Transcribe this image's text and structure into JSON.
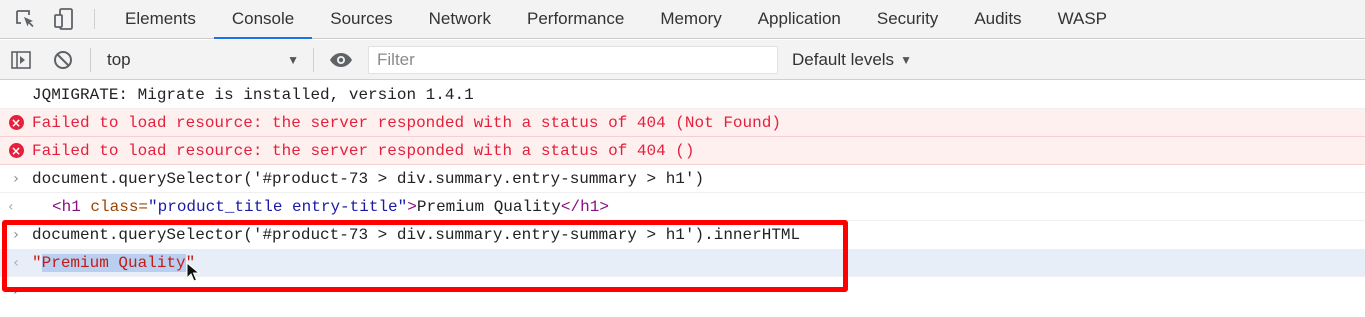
{
  "tabs": [
    {
      "label": "Elements",
      "active": false
    },
    {
      "label": "Console",
      "active": true
    },
    {
      "label": "Sources",
      "active": false
    },
    {
      "label": "Network",
      "active": false
    },
    {
      "label": "Performance",
      "active": false
    },
    {
      "label": "Memory",
      "active": false
    },
    {
      "label": "Application",
      "active": false
    },
    {
      "label": "Security",
      "active": false
    },
    {
      "label": "Audits",
      "active": false
    },
    {
      "label": "WASP",
      "active": false
    }
  ],
  "toolbar": {
    "context_label": "top",
    "filter_placeholder": "Filter",
    "levels_label": "Default levels"
  },
  "console": {
    "log_jqmigrate": "JQMIGRATE: Migrate is installed, version 1.4.1",
    "error_1": "Failed to load resource: the server responded with a status of 404 (Not Found)",
    "error_2": "Failed to load resource: the server responded with a status of 404 ()",
    "command_1": "document.querySelector('#product-73 > div.summary.entry-summary > h1')",
    "result_1": {
      "open_tag_start": "<h1 ",
      "attr_name": "class=",
      "attr_value": "\"product_title entry-title\"",
      "open_tag_end": ">",
      "text": "Premium Quality",
      "close_tag": "</h1>"
    },
    "command_2": "document.querySelector('#product-73 > div.summary.entry-summary > h1').innerHTML",
    "result_2": {
      "quote_open": "\"",
      "value": "Premium Quality",
      "quote_close": "\""
    }
  },
  "colors": {
    "accent": "#1a73e8",
    "error": "#e4213d",
    "highlight_box": "#ff0000"
  },
  "icons": [
    "inspect-element-icon",
    "device-toolbar-icon",
    "sidebar-toggle-icon",
    "clear-console-icon",
    "eye-icon",
    "error-icon",
    "chevron-right-icon",
    "chevron-left-icon"
  ]
}
